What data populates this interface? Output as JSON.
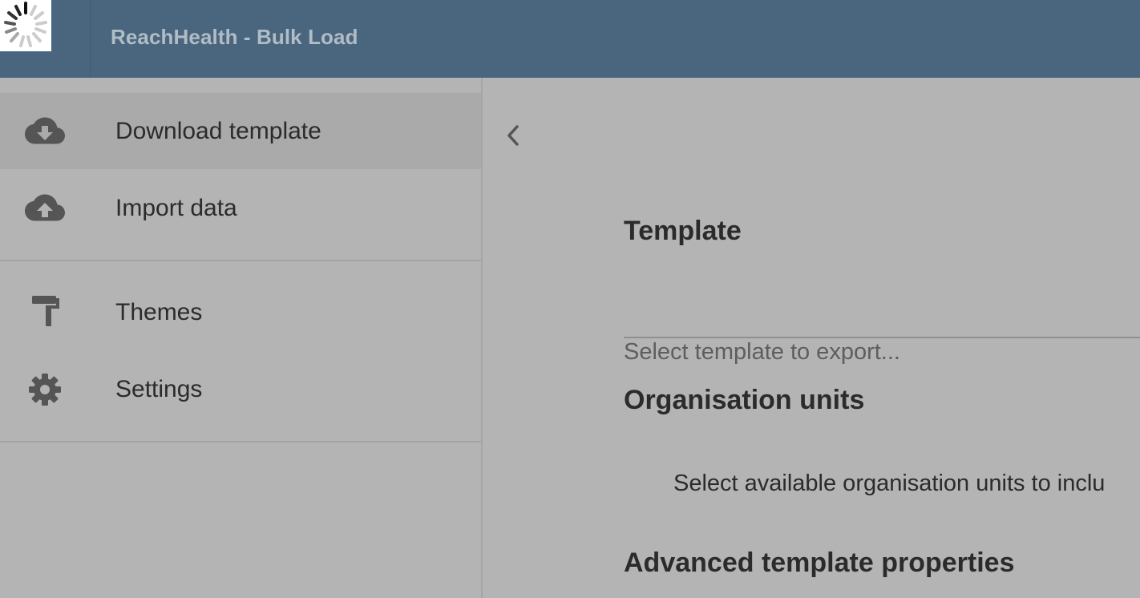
{
  "header": {
    "app_title": "ReachHealth - Bulk Load",
    "loading_icon": "spinner-icon"
  },
  "sidebar": {
    "items": [
      {
        "label": "Download template",
        "icon": "cloud-download-icon",
        "active": true
      },
      {
        "label": "Import data",
        "icon": "cloud-upload-icon",
        "active": false
      },
      {
        "label": "Themes",
        "icon": "paint-roller-icon",
        "active": false
      },
      {
        "label": "Settings",
        "icon": "gear-icon",
        "active": false
      }
    ]
  },
  "main": {
    "back_icon": "chevron-left-icon",
    "template_title": "Template",
    "template_select_placeholder": "Select template to export...",
    "org_units_title": "Organisation units",
    "org_units_description": "Select available organisation units to inclu",
    "advanced_title": "Advanced template properties"
  },
  "colors": {
    "header_bg": "#4a667e",
    "page_bg": "#b4b4b4",
    "active_item_bg": "#aaaaaa",
    "text": "#2b2b2b",
    "icon": "#555555"
  }
}
